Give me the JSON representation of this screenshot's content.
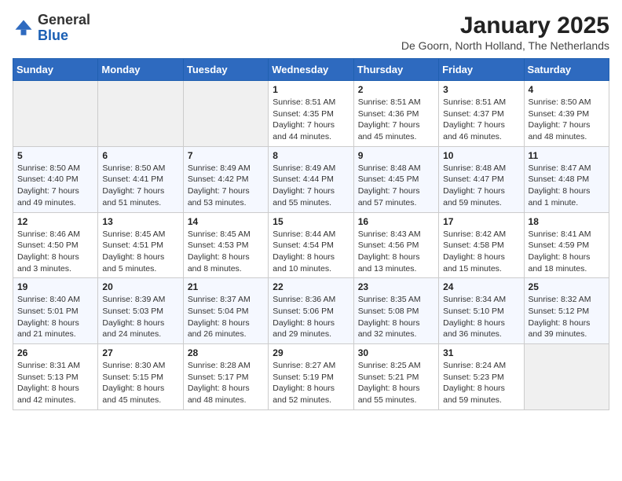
{
  "logo": {
    "general": "General",
    "blue": "Blue"
  },
  "title": "January 2025",
  "subtitle": "De Goorn, North Holland, The Netherlands",
  "weekdays": [
    "Sunday",
    "Monday",
    "Tuesday",
    "Wednesday",
    "Thursday",
    "Friday",
    "Saturday"
  ],
  "weeks": [
    [
      {
        "day": "",
        "info": ""
      },
      {
        "day": "",
        "info": ""
      },
      {
        "day": "",
        "info": ""
      },
      {
        "day": "1",
        "info": "Sunrise: 8:51 AM\nSunset: 4:35 PM\nDaylight: 7 hours\nand 44 minutes."
      },
      {
        "day": "2",
        "info": "Sunrise: 8:51 AM\nSunset: 4:36 PM\nDaylight: 7 hours\nand 45 minutes."
      },
      {
        "day": "3",
        "info": "Sunrise: 8:51 AM\nSunset: 4:37 PM\nDaylight: 7 hours\nand 46 minutes."
      },
      {
        "day": "4",
        "info": "Sunrise: 8:50 AM\nSunset: 4:39 PM\nDaylight: 7 hours\nand 48 minutes."
      }
    ],
    [
      {
        "day": "5",
        "info": "Sunrise: 8:50 AM\nSunset: 4:40 PM\nDaylight: 7 hours\nand 49 minutes."
      },
      {
        "day": "6",
        "info": "Sunrise: 8:50 AM\nSunset: 4:41 PM\nDaylight: 7 hours\nand 51 minutes."
      },
      {
        "day": "7",
        "info": "Sunrise: 8:49 AM\nSunset: 4:42 PM\nDaylight: 7 hours\nand 53 minutes."
      },
      {
        "day": "8",
        "info": "Sunrise: 8:49 AM\nSunset: 4:44 PM\nDaylight: 7 hours\nand 55 minutes."
      },
      {
        "day": "9",
        "info": "Sunrise: 8:48 AM\nSunset: 4:45 PM\nDaylight: 7 hours\nand 57 minutes."
      },
      {
        "day": "10",
        "info": "Sunrise: 8:48 AM\nSunset: 4:47 PM\nDaylight: 7 hours\nand 59 minutes."
      },
      {
        "day": "11",
        "info": "Sunrise: 8:47 AM\nSunset: 4:48 PM\nDaylight: 8 hours\nand 1 minute."
      }
    ],
    [
      {
        "day": "12",
        "info": "Sunrise: 8:46 AM\nSunset: 4:50 PM\nDaylight: 8 hours\nand 3 minutes."
      },
      {
        "day": "13",
        "info": "Sunrise: 8:45 AM\nSunset: 4:51 PM\nDaylight: 8 hours\nand 5 minutes."
      },
      {
        "day": "14",
        "info": "Sunrise: 8:45 AM\nSunset: 4:53 PM\nDaylight: 8 hours\nand 8 minutes."
      },
      {
        "day": "15",
        "info": "Sunrise: 8:44 AM\nSunset: 4:54 PM\nDaylight: 8 hours\nand 10 minutes."
      },
      {
        "day": "16",
        "info": "Sunrise: 8:43 AM\nSunset: 4:56 PM\nDaylight: 8 hours\nand 13 minutes."
      },
      {
        "day": "17",
        "info": "Sunrise: 8:42 AM\nSunset: 4:58 PM\nDaylight: 8 hours\nand 15 minutes."
      },
      {
        "day": "18",
        "info": "Sunrise: 8:41 AM\nSunset: 4:59 PM\nDaylight: 8 hours\nand 18 minutes."
      }
    ],
    [
      {
        "day": "19",
        "info": "Sunrise: 8:40 AM\nSunset: 5:01 PM\nDaylight: 8 hours\nand 21 minutes."
      },
      {
        "day": "20",
        "info": "Sunrise: 8:39 AM\nSunset: 5:03 PM\nDaylight: 8 hours\nand 24 minutes."
      },
      {
        "day": "21",
        "info": "Sunrise: 8:37 AM\nSunset: 5:04 PM\nDaylight: 8 hours\nand 26 minutes."
      },
      {
        "day": "22",
        "info": "Sunrise: 8:36 AM\nSunset: 5:06 PM\nDaylight: 8 hours\nand 29 minutes."
      },
      {
        "day": "23",
        "info": "Sunrise: 8:35 AM\nSunset: 5:08 PM\nDaylight: 8 hours\nand 32 minutes."
      },
      {
        "day": "24",
        "info": "Sunrise: 8:34 AM\nSunset: 5:10 PM\nDaylight: 8 hours\nand 36 minutes."
      },
      {
        "day": "25",
        "info": "Sunrise: 8:32 AM\nSunset: 5:12 PM\nDaylight: 8 hours\nand 39 minutes."
      }
    ],
    [
      {
        "day": "26",
        "info": "Sunrise: 8:31 AM\nSunset: 5:13 PM\nDaylight: 8 hours\nand 42 minutes."
      },
      {
        "day": "27",
        "info": "Sunrise: 8:30 AM\nSunset: 5:15 PM\nDaylight: 8 hours\nand 45 minutes."
      },
      {
        "day": "28",
        "info": "Sunrise: 8:28 AM\nSunset: 5:17 PM\nDaylight: 8 hours\nand 48 minutes."
      },
      {
        "day": "29",
        "info": "Sunrise: 8:27 AM\nSunset: 5:19 PM\nDaylight: 8 hours\nand 52 minutes."
      },
      {
        "day": "30",
        "info": "Sunrise: 8:25 AM\nSunset: 5:21 PM\nDaylight: 8 hours\nand 55 minutes."
      },
      {
        "day": "31",
        "info": "Sunrise: 8:24 AM\nSunset: 5:23 PM\nDaylight: 8 hours\nand 59 minutes."
      },
      {
        "day": "",
        "info": ""
      }
    ]
  ]
}
